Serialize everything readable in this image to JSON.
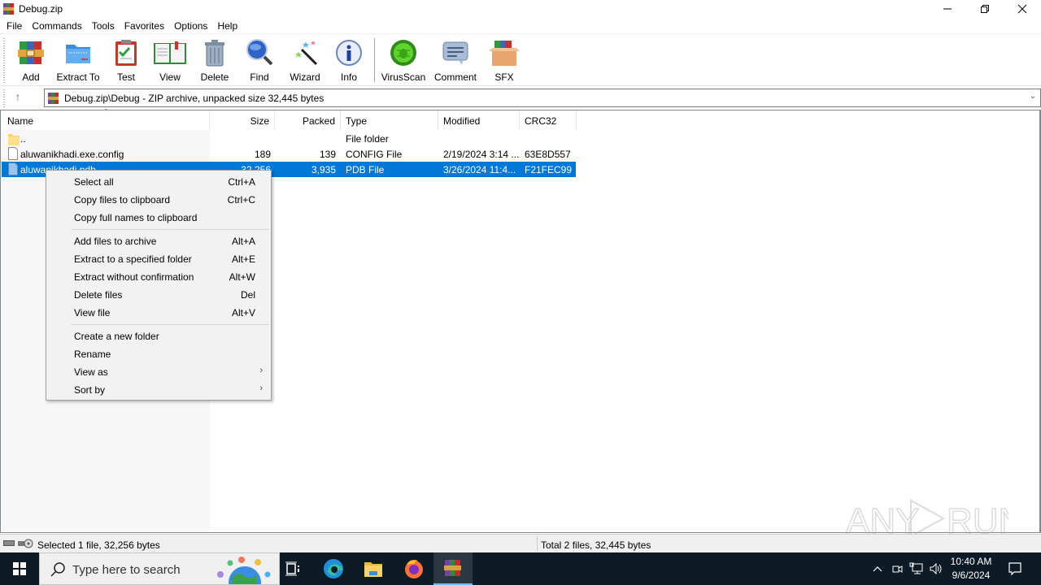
{
  "window": {
    "title": "Debug.zip",
    "controls": {
      "minimize": "minimize",
      "restore": "restore",
      "close": "close"
    }
  },
  "menubar": [
    "File",
    "Commands",
    "Tools",
    "Favorites",
    "Options",
    "Help"
  ],
  "toolbar": {
    "buttons": [
      {
        "label": "Add",
        "icon": "add-archive-icon"
      },
      {
        "label": "Extract To",
        "icon": "extract-folder-icon"
      },
      {
        "label": "Test",
        "icon": "test-clipboard-icon"
      },
      {
        "label": "View",
        "icon": "view-book-icon"
      },
      {
        "label": "Delete",
        "icon": "trash-icon"
      },
      {
        "label": "Find",
        "icon": "magnifier-icon"
      },
      {
        "label": "Wizard",
        "icon": "magic-wand-icon"
      },
      {
        "label": "Info",
        "icon": "info-icon"
      },
      {
        "label": "VirusScan",
        "icon": "virus-scan-icon"
      },
      {
        "label": "Comment",
        "icon": "comment-icon"
      },
      {
        "label": "SFX",
        "icon": "sfx-box-icon"
      }
    ]
  },
  "address": {
    "path": "Debug.zip\\Debug - ZIP archive, unpacked size 32,445 bytes"
  },
  "list": {
    "columns": [
      "Name",
      "Size",
      "Packed",
      "Type",
      "Modified",
      "CRC32"
    ],
    "rows": [
      {
        "name": "..",
        "size": "",
        "packed": "",
        "type": "File folder",
        "modified": "",
        "crc": "",
        "icon": "folder",
        "selected": false
      },
      {
        "name": "aluwanikhadi.exe.config",
        "size": "189",
        "packed": "139",
        "type": "CONFIG File",
        "modified": "2/19/2024 3:14 ...",
        "crc": "63E8D557",
        "icon": "file",
        "selected": false
      },
      {
        "name": "aluwanikhadi.pdb",
        "size": "32,256",
        "packed": "3,935",
        "type": "PDB File",
        "modified": "3/26/2024 11:4...",
        "crc": "F21FEC99",
        "icon": "file",
        "selected": true
      }
    ]
  },
  "context_menu": {
    "groups": [
      [
        {
          "label": "Select all",
          "shortcut": "Ctrl+A"
        },
        {
          "label": "Copy files to clipboard",
          "shortcut": "Ctrl+C"
        },
        {
          "label": "Copy full names to clipboard",
          "shortcut": ""
        }
      ],
      [
        {
          "label": "Add files to archive",
          "shortcut": "Alt+A"
        },
        {
          "label": "Extract to a specified folder",
          "shortcut": "Alt+E"
        },
        {
          "label": "Extract without confirmation",
          "shortcut": "Alt+W"
        },
        {
          "label": "Delete files",
          "shortcut": "Del"
        },
        {
          "label": "View file",
          "shortcut": "Alt+V"
        }
      ],
      [
        {
          "label": "Create a new folder",
          "shortcut": ""
        },
        {
          "label": "Rename",
          "shortcut": ""
        },
        {
          "label": "View as",
          "shortcut": "",
          "submenu": true
        },
        {
          "label": "Sort by",
          "shortcut": "",
          "submenu": true
        }
      ]
    ]
  },
  "status": {
    "left": "Selected 1 file, 32,256 bytes",
    "right": "Total 2 files, 32,445 bytes"
  },
  "watermark": "ANY RUN",
  "taskbar": {
    "search_placeholder": "Type here to search",
    "apps": [
      "task-view",
      "edge",
      "file-explorer",
      "firefox",
      "winrar"
    ],
    "active_app": "winrar",
    "clock_time": "10:40 AM",
    "clock_date": "9/6/2024"
  },
  "colors": {
    "selection": "#0078d7",
    "taskbar": "#0d1b26",
    "menu_bg": "#f2f2f2"
  }
}
